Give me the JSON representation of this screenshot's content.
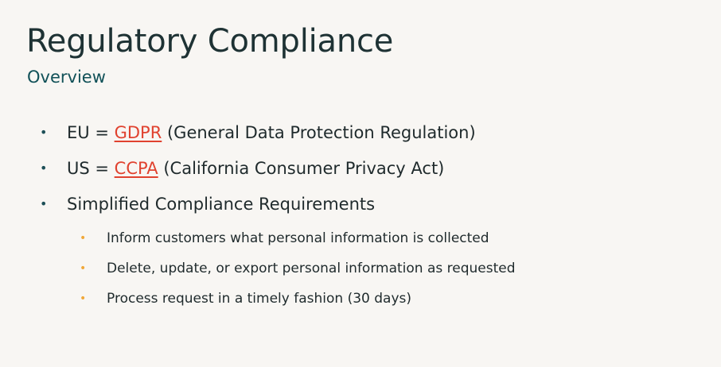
{
  "slide": {
    "title": "Regulatory Compliance",
    "subtitle": "Overview",
    "bullets": [
      {
        "prefix": "EU = ",
        "link": "GDPR",
        "suffix": " (General Data Protection Regulation)"
      },
      {
        "prefix": "US = ",
        "link": "CCPA",
        "suffix": " (California Consumer Privacy Act)"
      },
      {
        "text": "Simplified Compliance Requirements",
        "sub": [
          "Inform customers what personal information is collected",
          "Delete, update, or export personal information as requested",
          "Process request in a timely fashion (30 days)"
        ]
      }
    ]
  },
  "colors": {
    "background": "#f8f6f3",
    "title": "#1e3234",
    "subtitle": "#115158",
    "link": "#e0422f",
    "bullet_l1": "#1d4f57",
    "bullet_l2": "#f0a83a"
  },
  "icons": {
    "bullet_l1": "bullet-dot-icon",
    "bullet_l2": "sub-bullet-dot-icon"
  }
}
